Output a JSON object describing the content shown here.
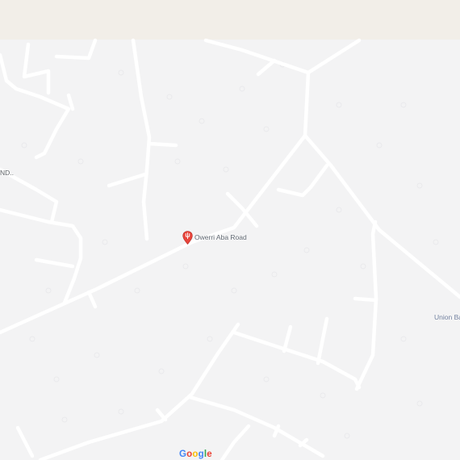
{
  "map": {
    "place_label_left": "ND..",
    "poi": {
      "name": "Owerri Aba Road",
      "icon": "map-pin-icon",
      "pin_color": "#e8453c"
    },
    "place_label_right": "Union Ba",
    "attribution": {
      "letters": [
        "G",
        "o",
        "o",
        "g",
        "l",
        "e"
      ],
      "colors": [
        "#4285f4",
        "#ea4335",
        "#fbbc05",
        "#4285f4",
        "#34a853",
        "#ea4335"
      ]
    }
  },
  "colors": {
    "background": "#f3f3f4",
    "top_band": "#f2eee8",
    "road": "#ffffff"
  }
}
